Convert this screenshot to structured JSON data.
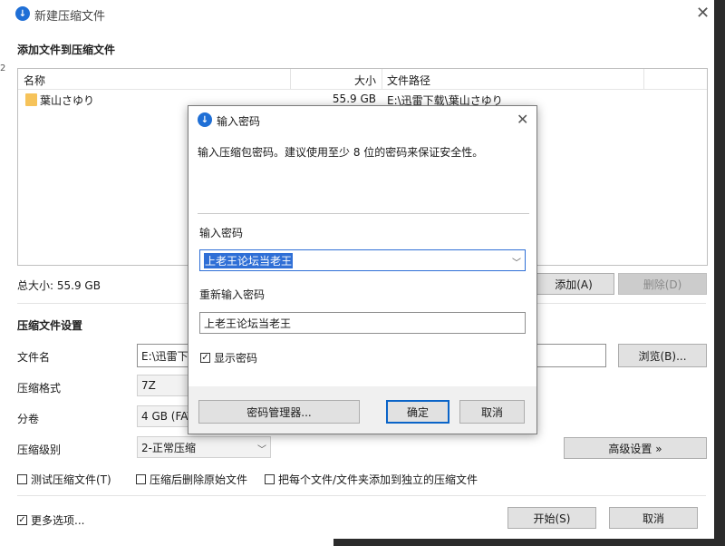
{
  "main": {
    "title": "新建压缩文件",
    "add_section_title": "添加文件到压缩文件",
    "columns": {
      "name": "名称",
      "size": "大小",
      "path": "文件路径"
    },
    "files": [
      {
        "name": "葉山さゆり",
        "size": "55.9 GB",
        "path": "E:\\迅雷下载\\葉山さゆり"
      }
    ],
    "total_size": "总大小: 55.9 GB",
    "add_button": "添加(A)",
    "delete_button": "删除(D)",
    "settings_title": "压缩文件设置",
    "filename_label": "文件名",
    "filename_value": "E:\\迅雷下载",
    "browse_button": "浏览(B)...",
    "format_label": "压缩格式",
    "format_value": "7Z",
    "split_label": "分卷",
    "split_value": "4 GB (FAT",
    "level_label": "压缩级别",
    "level_value": "2-正常压缩",
    "advanced_button": "高级设置 »",
    "test_archive": "测试压缩文件(T)",
    "delete_after": "压缩后删除原始文件",
    "separate_archives": "把每个文件/文件夹添加到独立的压缩文件",
    "more_options": "更多选项...",
    "start_button": "开始(S)",
    "cancel_button": "取消"
  },
  "dialog": {
    "title": "输入密码",
    "description": "输入压缩包密码。建议使用至少 8 位的密码来保证安全性。",
    "password_label": "输入密码",
    "password_value": "上老王论坛当老王",
    "reenter_label": "重新输入密码",
    "reenter_value": "上老王论坛当老王",
    "show_password": "显示密码",
    "show_password_checked": true,
    "manager_button": "密码管理器...",
    "ok_button": "确定",
    "cancel_button": "取消"
  },
  "colors": {
    "accent": "#1f6fd6",
    "folder": "#f6c35a",
    "primary_border": "#0a64c8"
  },
  "icons": {
    "app": "app-logo-icon",
    "folder": "folder-icon",
    "close": "close-icon",
    "dropdown": "chevron-down-icon",
    "check": "checkmark-icon"
  }
}
